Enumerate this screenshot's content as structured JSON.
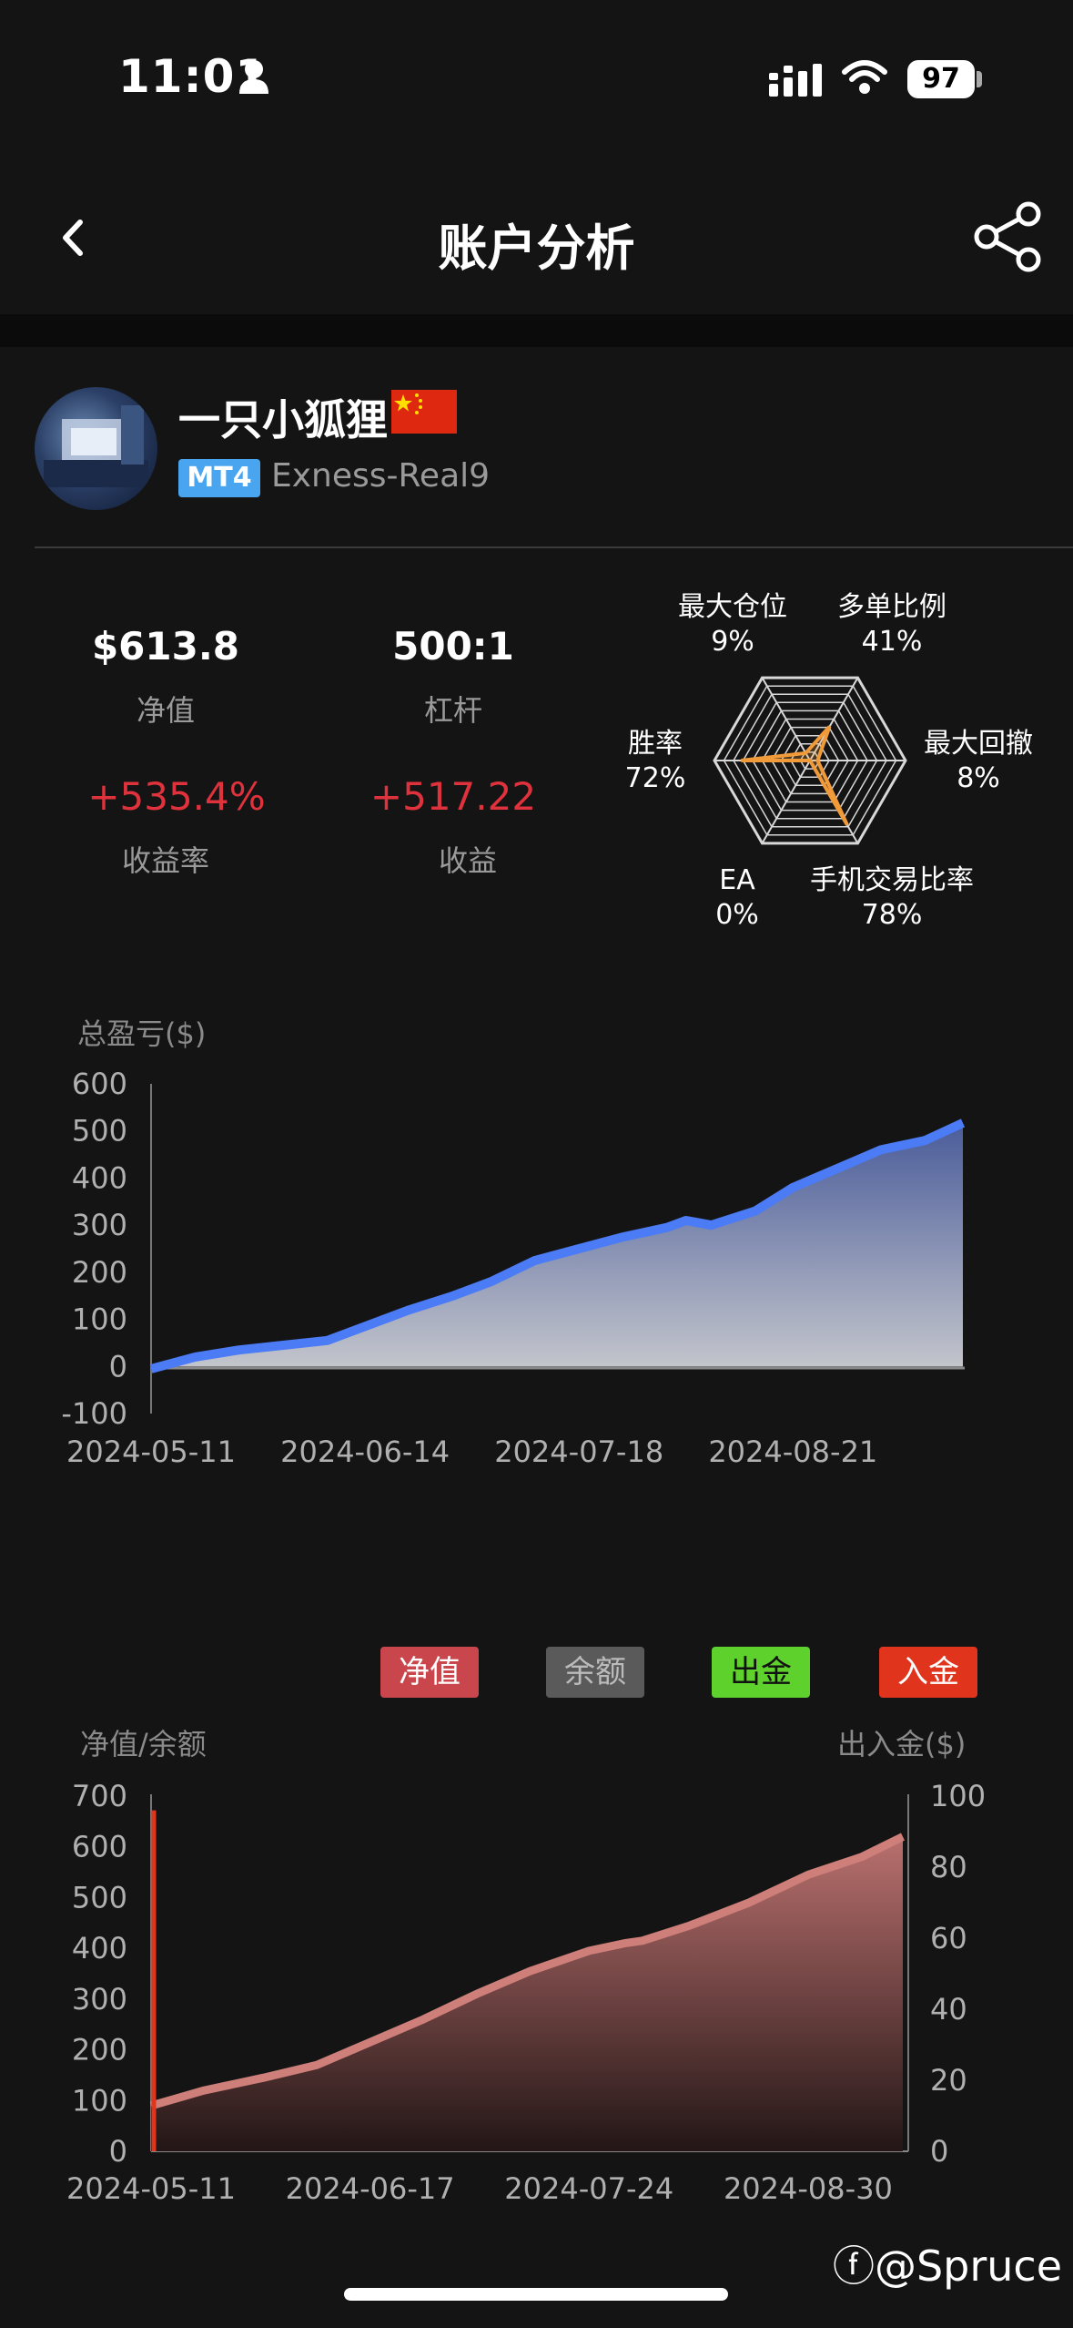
{
  "status_bar": {
    "time": "11:01",
    "battery": "97"
  },
  "nav": {
    "title": "账户分析"
  },
  "profile": {
    "name": "一只小狐狸",
    "platform": "MT4",
    "server": "Exness-Real9"
  },
  "stats": [
    {
      "value": "$613.8",
      "label": "净值"
    },
    {
      "value": "500:1",
      "label": "杠杆"
    },
    {
      "value": "+535.4%",
      "label": "收益率"
    },
    {
      "value": "+517.22",
      "label": "收益"
    }
  ],
  "radar": {
    "axes": [
      {
        "name": "多单比例",
        "value": "41%",
        "pct": 41
      },
      {
        "name": "最大回撤",
        "value": "8%",
        "pct": 8
      },
      {
        "name": "手机交易比率",
        "value": "78%",
        "pct": 78
      },
      {
        "name": "EA",
        "value": "0%",
        "pct": 0
      },
      {
        "name": "胜率",
        "value": "72%",
        "pct": 72
      },
      {
        "name": "最大仓位",
        "value": "9%",
        "pct": 9
      }
    ],
    "accent": "#f09a3a"
  },
  "chart_data": [
    {
      "type": "area",
      "ylabel": "总盈亏($)",
      "x_ticks": [
        "2024-05-11",
        "2024-06-14",
        "2024-07-18",
        "2024-08-21"
      ],
      "y_ticks": [
        "600",
        "500",
        "400",
        "300",
        "200",
        "100",
        "0",
        "-100"
      ],
      "ylim": [
        -100,
        600
      ],
      "x": [
        "2024-05-11",
        "2024-05-18",
        "2024-05-25",
        "2024-06-01",
        "2024-06-08",
        "2024-06-14",
        "2024-06-21",
        "2024-06-28",
        "2024-07-04",
        "2024-07-11",
        "2024-07-18",
        "2024-07-25",
        "2024-08-01",
        "2024-08-04",
        "2024-08-08",
        "2024-08-15",
        "2024-08-21",
        "2024-08-28",
        "2024-09-04",
        "2024-09-11",
        "2024-09-17"
      ],
      "values": [
        -5,
        20,
        35,
        45,
        55,
        85,
        120,
        150,
        180,
        225,
        250,
        275,
        295,
        310,
        300,
        330,
        380,
        420,
        460,
        480,
        517
      ],
      "color": "#4b7bf5"
    },
    {
      "type": "area",
      "ylabel": "净值/余额",
      "y2label": "出入金($)",
      "legend": [
        {
          "label": "净值",
          "color": "#c9474c"
        },
        {
          "label": "余额",
          "color": "#5a5a5a"
        },
        {
          "label": "出金",
          "color": "#5fd12c"
        },
        {
          "label": "入金",
          "color": "#e0341c"
        }
      ],
      "x_ticks": [
        "2024-05-11",
        "2024-06-17",
        "2024-07-24",
        "2024-08-30"
      ],
      "y_ticks": [
        "700",
        "600",
        "500",
        "400",
        "300",
        "200",
        "100",
        "0"
      ],
      "y2_ticks": [
        "100",
        "80",
        "60",
        "40",
        "20",
        "0"
      ],
      "ylim": [
        0,
        700
      ],
      "y2lim": [
        0,
        100
      ],
      "x": [
        "2024-05-11",
        "2024-05-20",
        "2024-05-30",
        "2024-06-08",
        "2024-06-17",
        "2024-06-26",
        "2024-07-05",
        "2024-07-14",
        "2024-07-24",
        "2024-07-30",
        "2024-08-02",
        "2024-08-10",
        "2024-08-20",
        "2024-08-30",
        "2024-09-08",
        "2024-09-15"
      ],
      "equity": [
        90,
        120,
        145,
        170,
        215,
        260,
        310,
        355,
        395,
        410,
        415,
        445,
        490,
        545,
        580,
        620
      ],
      "deposit_x": "2024-05-11",
      "deposit_value": 96
    }
  ]
}
